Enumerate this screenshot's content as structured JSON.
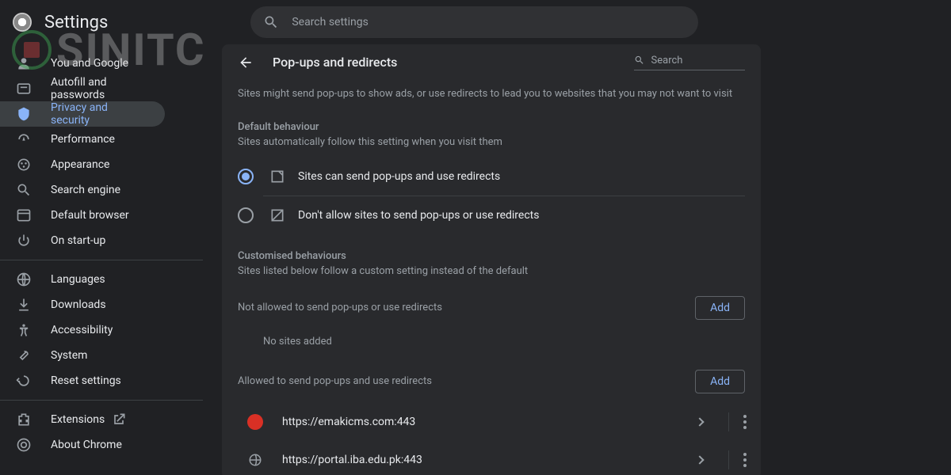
{
  "header": {
    "title": "Settings",
    "search_placeholder": "Search settings"
  },
  "sidebar": {
    "items": [
      {
        "id": "you-google",
        "label": "You and Google",
        "icon": "person"
      },
      {
        "id": "autofill",
        "label": "Autofill and passwords",
        "icon": "autofill"
      },
      {
        "id": "privacy",
        "label": "Privacy and security",
        "icon": "shield",
        "active": true
      },
      {
        "id": "performance",
        "label": "Performance",
        "icon": "speed"
      },
      {
        "id": "appearance",
        "label": "Appearance",
        "icon": "brush"
      },
      {
        "id": "search-engine",
        "label": "Search engine",
        "icon": "search"
      },
      {
        "id": "default-browser",
        "label": "Default browser",
        "icon": "browser"
      },
      {
        "id": "startup",
        "label": "On start-up",
        "icon": "power"
      }
    ],
    "advanced": [
      {
        "id": "languages",
        "label": "Languages",
        "icon": "globe"
      },
      {
        "id": "downloads",
        "label": "Downloads",
        "icon": "download"
      },
      {
        "id": "accessibility",
        "label": "Accessibility",
        "icon": "accessibility"
      },
      {
        "id": "system",
        "label": "System",
        "icon": "wrench"
      },
      {
        "id": "reset",
        "label": "Reset settings",
        "icon": "reset"
      }
    ],
    "footer": [
      {
        "id": "extensions",
        "label": "Extensions",
        "icon": "extension",
        "external": true
      },
      {
        "id": "about",
        "label": "About Chrome",
        "icon": "chrome"
      }
    ]
  },
  "page": {
    "title": "Pop-ups and redirects",
    "search_placeholder": "Search",
    "description": "Sites might send pop-ups to show ads, or use redirects to lead you to websites that you may not want to visit",
    "default_behaviour_title": "Default behaviour",
    "default_behaviour_sub": "Sites automatically follow this setting when you visit them",
    "option_allow": "Sites can send pop-ups and use redirects",
    "option_block": "Don't allow sites to send pop-ups or use redirects",
    "customised_title": "Customised behaviours",
    "customised_sub": "Sites listed below follow a custom setting instead of the default",
    "not_allowed_title": "Not allowed to send pop-ups or use redirects",
    "no_sites": "No sites added",
    "allowed_title": "Allowed to send pop-ups and use redirects",
    "add_label": "Add",
    "allowed_sites": [
      {
        "url": "https://emakicms.com:443",
        "icon": "red"
      },
      {
        "url": "https://portal.iba.edu.pk:443",
        "icon": "globe"
      }
    ]
  },
  "watermark": "SINITC"
}
